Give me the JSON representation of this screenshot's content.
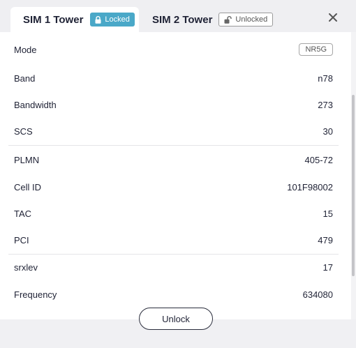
{
  "tabs": [
    {
      "label": "SIM 1 Tower",
      "badge": "Locked",
      "badge_icon": "lock-icon",
      "active": true
    },
    {
      "label": "SIM 2 Tower",
      "badge": "Unlocked",
      "badge_icon": "unlock-icon",
      "active": false
    }
  ],
  "close_icon": "close-icon",
  "rows": [
    {
      "label": "Mode",
      "value": "NR5G"
    },
    {
      "label": "Band",
      "value": "n78"
    },
    {
      "label": "Bandwidth",
      "value": "273"
    },
    {
      "label": "SCS",
      "value": "30"
    },
    {
      "label": "PLMN",
      "value": "405-72"
    },
    {
      "label": "Cell ID",
      "value": "101F98002"
    },
    {
      "label": "TAC",
      "value": "15"
    },
    {
      "label": "PCI",
      "value": "479"
    },
    {
      "label": "srxlev",
      "value": "17"
    },
    {
      "label": "Frequency",
      "value": "634080"
    }
  ],
  "unlock_button": "Unlock",
  "colors": {
    "locked_badge": "#4aa8c8",
    "text": "#1f2235",
    "background": "#f0f0f3"
  }
}
